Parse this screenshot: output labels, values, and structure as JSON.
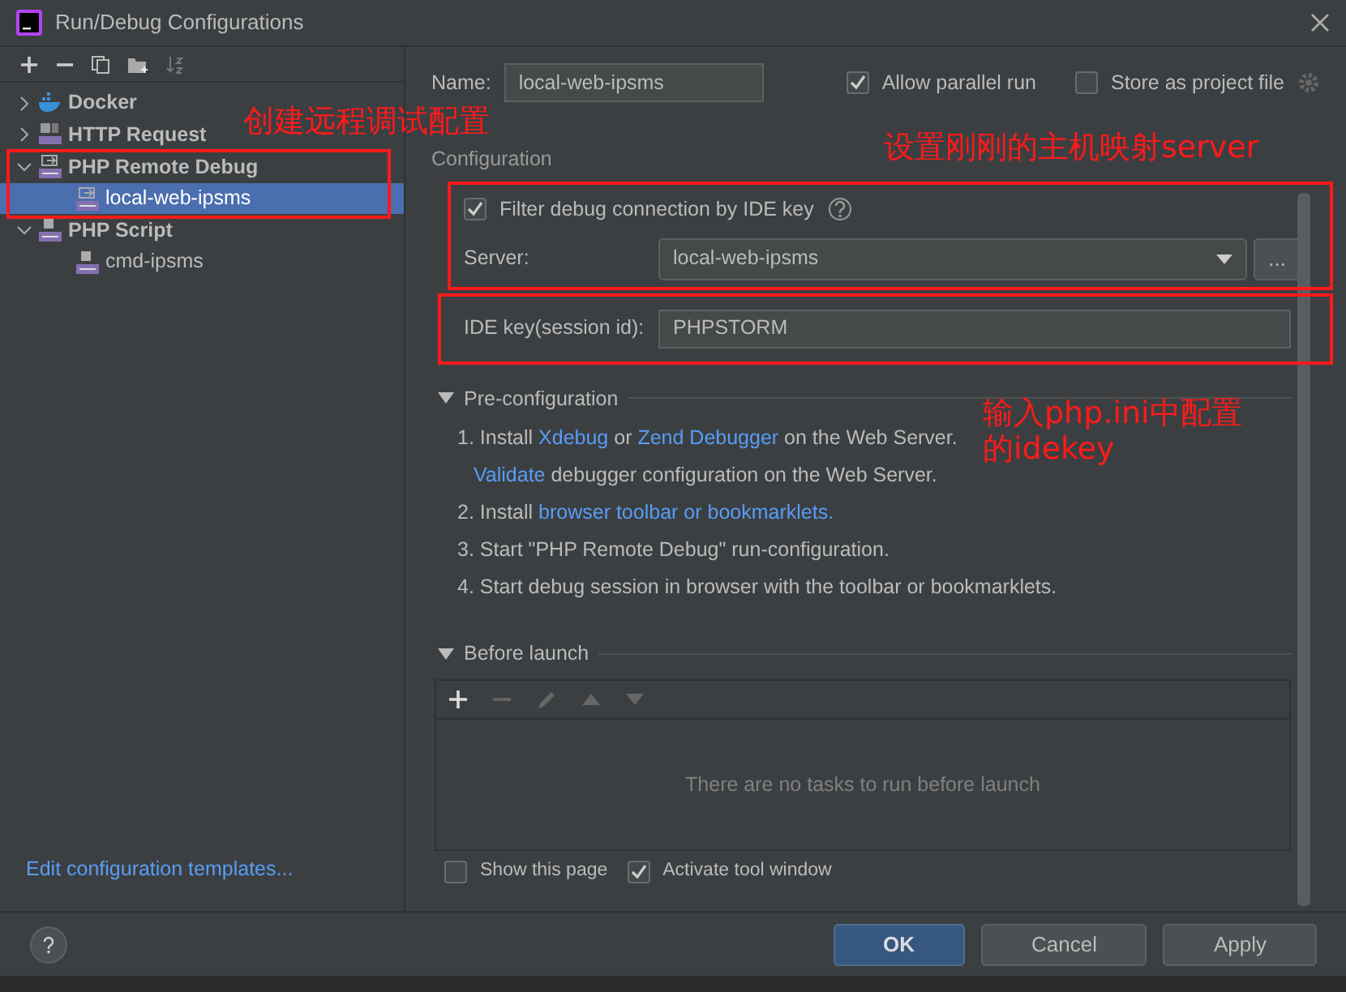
{
  "window": {
    "title": "Run/Debug Configurations"
  },
  "tree": [
    {
      "label": "Docker",
      "kind": "docker",
      "expanded": false,
      "selected": false
    },
    {
      "label": "HTTP Request",
      "kind": "http",
      "expanded": false,
      "selected": false
    },
    {
      "label": "PHP Remote Debug",
      "kind": "remote",
      "expanded": true,
      "selected": false,
      "children": [
        {
          "label": "local-web-ipsms",
          "kind": "remote",
          "selected": true
        }
      ]
    },
    {
      "label": "PHP Script",
      "kind": "script",
      "expanded": true,
      "selected": false,
      "children": [
        {
          "label": "cmd-ipsms",
          "kind": "script",
          "selected": false
        }
      ]
    }
  ],
  "edit_templates_link": "Edit configuration templates...",
  "name": {
    "label": "Name:",
    "value": "local-web-ipsms"
  },
  "allow_parallel_run": {
    "label": "Allow parallel run",
    "checked": true
  },
  "store_as_project_file": {
    "label": "Store as project file",
    "checked": false
  },
  "configuration": {
    "title": "Configuration",
    "filter": {
      "label": "Filter debug connection by IDE key",
      "checked": true
    },
    "server": {
      "label": "Server:",
      "value": "local-web-ipsms",
      "browse": "..."
    },
    "ide_key": {
      "label": "IDE key(session id):",
      "value": "PHPSTORM"
    }
  },
  "pre_configuration": {
    "title": "Pre-configuration",
    "expanded": true,
    "steps": [
      [
        {
          "text": "1. Install ",
          "link": false
        },
        {
          "text": "Xdebug",
          "link": true
        },
        {
          "text": " or ",
          "link": false
        },
        {
          "text": "Zend Debugger",
          "link": true
        },
        {
          "text": " on the Web Server.",
          "link": false
        }
      ],
      [
        {
          "text": "Validate",
          "link": true
        },
        {
          "text": " debugger configuration on the Web Server.",
          "link": false
        }
      ],
      [
        {
          "text": "2. Install ",
          "link": false
        },
        {
          "text": "browser toolbar or bookmarklets.",
          "link": true
        }
      ],
      [
        {
          "text": "3. Start \"PHP Remote Debug\" run-configuration.",
          "link": false
        }
      ],
      [
        {
          "text": "4. Start debug session in browser with the toolbar or bookmarklets.",
          "link": false
        }
      ]
    ]
  },
  "before_launch": {
    "title": "Before launch",
    "expanded": true,
    "empty_text": "There are no tasks to run before launch",
    "show_this_page": {
      "label": "Show this page",
      "checked": false
    },
    "activate_tool_window": {
      "label": "Activate tool window",
      "checked": true
    }
  },
  "buttons": [
    {
      "label": "OK",
      "kind": "primary"
    },
    {
      "label": "Cancel",
      "kind": "secondary"
    },
    {
      "label": "Apply",
      "kind": "secondary"
    }
  ],
  "annotations": [
    {
      "lines": [
        "创建远程调试配置"
      ]
    },
    {
      "lines": [
        "设置刚刚的主机映射server"
      ]
    },
    {
      "lines": [
        "输入php.ini中配置",
        "的idekey"
      ]
    }
  ]
}
